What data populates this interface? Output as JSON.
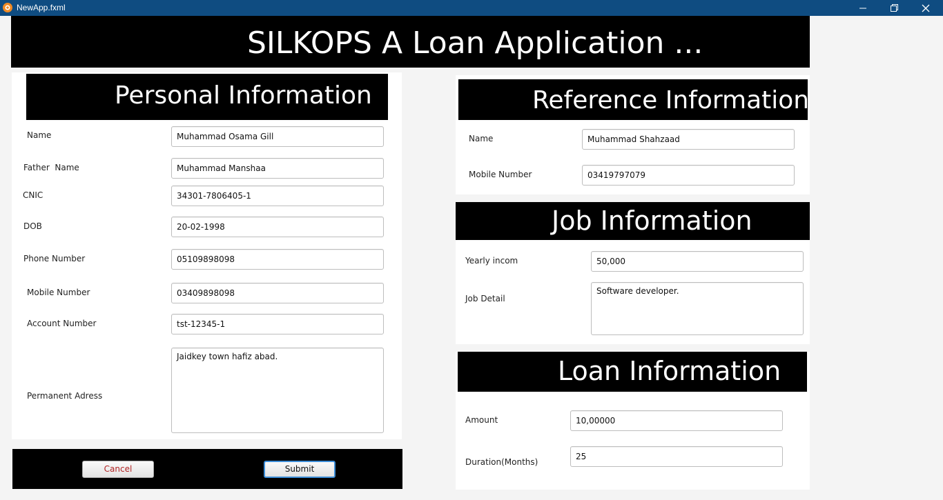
{
  "window": {
    "title": "NewApp.fxml"
  },
  "header": {
    "title": "SILKOPS A Loan Application ..."
  },
  "personal": {
    "heading": "Personal Information",
    "name_label": "Name",
    "name_value": "Muhammad Osama Gill",
    "father_label": "Father  Name",
    "father_value": "Muhammad Manshaa",
    "cnic_label": "CNIC",
    "cnic_value": "34301-7806405-1",
    "dob_label": "DOB",
    "dob_value": "20-02-1998",
    "phone_label": "Phone Number",
    "phone_value": "05109898098",
    "mobile_label": "Mobile Number",
    "mobile_value": "03409898098",
    "account_label": "Account Number",
    "account_value": "tst-12345-1",
    "address_label": "Permanent Adress",
    "address_value": "Jaidkey town hafiz abad."
  },
  "reference": {
    "heading": "Reference Information",
    "name_label": "Name",
    "name_value": "Muhammad Shahzaad",
    "mobile_label": "Mobile Number",
    "mobile_value": "03419797079"
  },
  "job": {
    "heading": "Job Information",
    "income_label": "Yearly incom",
    "income_value": "50,000",
    "detail_label": "Job Detail",
    "detail_value": "Software developer."
  },
  "loan": {
    "heading": "Loan Information",
    "amount_label": "Amount",
    "amount_value": "10,00000",
    "duration_label": "Duration(Months)",
    "duration_value": "25"
  },
  "actions": {
    "cancel_label": "Cancel",
    "submit_label": "Submit"
  },
  "colors": {
    "titlebar": "#0f4c81",
    "header": "#000000",
    "cancel_text": "#b22222",
    "focus_border": "#3c8dd8"
  }
}
